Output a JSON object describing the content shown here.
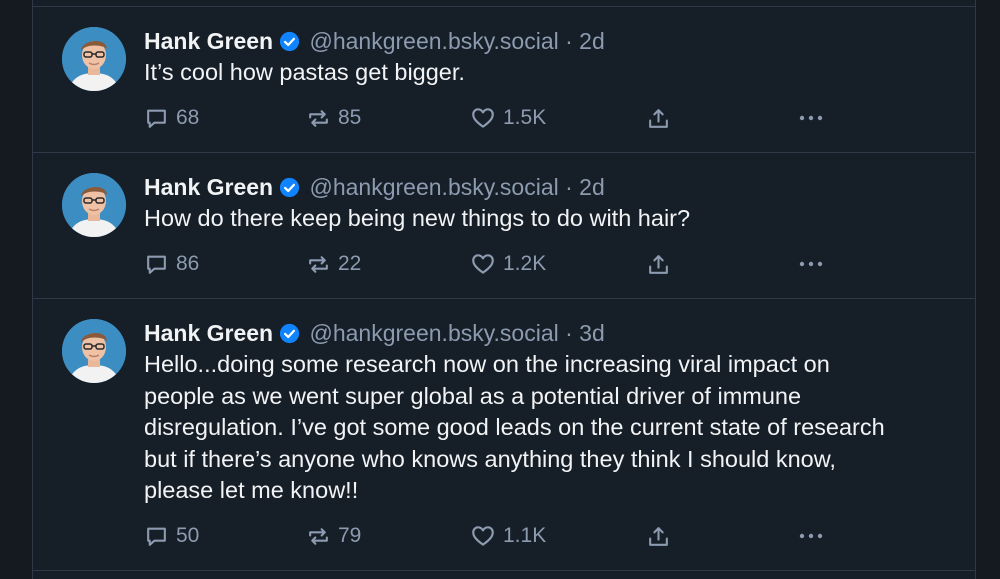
{
  "posts": [
    {
      "author": "Hank Green",
      "handle": "@hankgreen.bsky.social",
      "separator": "·",
      "time": "2d",
      "text": "It’s cool how pastas get bigger.",
      "replies": "68",
      "reposts": "85",
      "likes": "1.5K"
    },
    {
      "author": "Hank Green",
      "handle": "@hankgreen.bsky.social",
      "separator": "·",
      "time": "2d",
      "text": "How do there keep being new things to do with hair?",
      "replies": "86",
      "reposts": "22",
      "likes": "1.2K"
    },
    {
      "author": "Hank Green",
      "handle": "@hankgreen.bsky.social",
      "separator": "·",
      "time": "3d",
      "text": "Hello...doing some research now on the increasing viral impact on\npeople as we went super global as a potential driver of immune\ndisregulation. I’ve got some good leads on the current state of research\nbut if there’s anyone who knows anything they think I should know,\nplease let me know!!",
      "replies": "50",
      "reposts": "79",
      "likes": "1.1K"
    }
  ],
  "icons": {
    "verified": "verified-badge-icon",
    "reply": "reply-icon",
    "repost": "repost-icon",
    "like": "heart-icon",
    "share": "share-icon",
    "more": "more-icon"
  },
  "colors": {
    "background": "#161e27",
    "text": "#f1f3f5",
    "muted": "#8c9bb0",
    "verified": "#1083fe",
    "divider": "#2e3a48"
  }
}
